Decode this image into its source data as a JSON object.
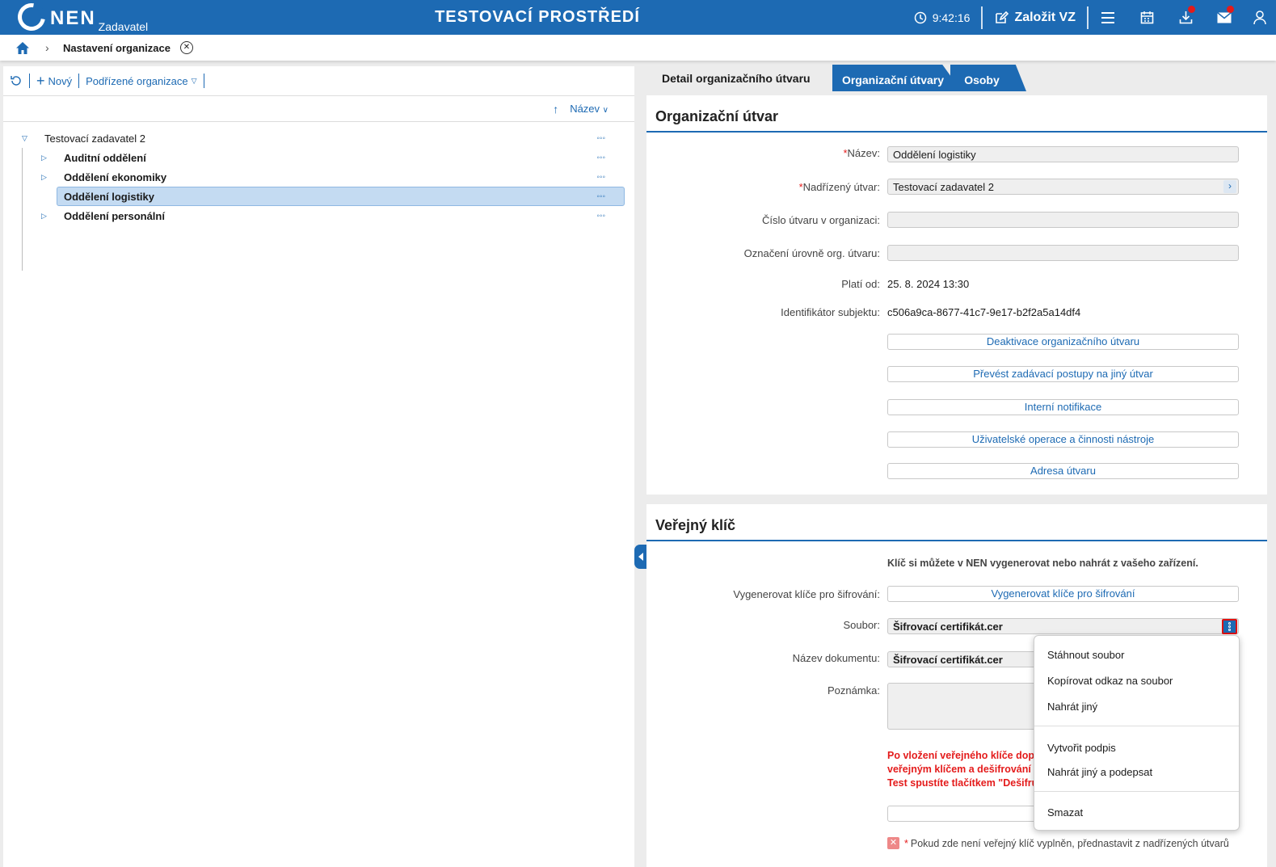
{
  "header": {
    "logo": "NEN",
    "logo_sub": "Zadavatel",
    "env_title": "TESTOVACÍ PROSTŘEDÍ",
    "time": "9:42:16",
    "create_vz": "Založit VZ"
  },
  "breadcrumb": {
    "current": "Nastavení organizace"
  },
  "toolbar": {
    "new_label": "Nový",
    "sub_orgs_label": "Podřízené organizace"
  },
  "sort": {
    "label": "Název"
  },
  "tree": {
    "root": "Testovací zadavatel 2",
    "items": [
      {
        "label": "Auditní oddělení"
      },
      {
        "label": "Oddělení ekonomiky"
      },
      {
        "label": "Oddělení logistiky"
      },
      {
        "label": "Oddělení personální"
      }
    ]
  },
  "tabs": {
    "detail": "Detail organizačního útvaru",
    "units": "Organizační útvary",
    "persons": "Osoby"
  },
  "org_card": {
    "title": "Organizační útvar",
    "name_label": "Název:",
    "name_value": "Oddělení logistiky",
    "parent_label": "Nadřízený útvar:",
    "parent_value": "Testovací zadavatel 2",
    "number_label": "Číslo útvaru v organizaci:",
    "level_label": "Označení úrovně org. útvaru:",
    "valid_label": "Platí od:",
    "valid_value": "25. 8. 2024 13:30",
    "id_label": "Identifikátor subjektu:",
    "id_value": "c506a9ca-8677-41c7-9e17-b2f2a5a14df4",
    "btn_deactivate": "Deaktivace organizačního útvaru",
    "btn_transfer": "Převést zadávací postupy na jiný útvar",
    "btn_notifications": "Interní notifikace",
    "btn_user_ops": "Uživatelské operace a činnosti nástroje",
    "btn_address": "Adresa útvaru"
  },
  "key_card": {
    "title": "Veřejný klíč",
    "info": "Klíč si můžete v NEN vygenerovat nebo nahrát z vašeho zařízení.",
    "generate_label": "Vygenerovat klíče pro šifrování:",
    "generate_btn": "Vygenerovat klíče pro šifrování",
    "file_label": "Soubor:",
    "file_value": "Šifrovací certifikát.cer",
    "doc_label": "Název dokumentu:",
    "doc_value": "Šifrovací certifikát.cer",
    "note_label": "Poznámka:",
    "warn_line1": "Po vložení veřejného klíče dopor",
    "warn_line2": "veřejným klíčem a dešifrování Va",
    "warn_line3": "Test spustíte tlačítkem \"Dešifruj\"",
    "preset_note": "Pokud zde není veřejný klíč vyplněn, přednastavit z nadřízených útvarů"
  },
  "file_menu": {
    "download": "Stáhnout soubor",
    "copy_link": "Kopírovat odkaz na soubor",
    "upload_other": "Nahrát jiný",
    "create_signature": "Vytvořit podpis",
    "upload_sign": "Nahrát jiný a podepsat",
    "delete": "Smazat"
  },
  "colors": {
    "brand": "#1d6ab3",
    "required": "#e41b1b",
    "selection": "#c4dbf2"
  }
}
